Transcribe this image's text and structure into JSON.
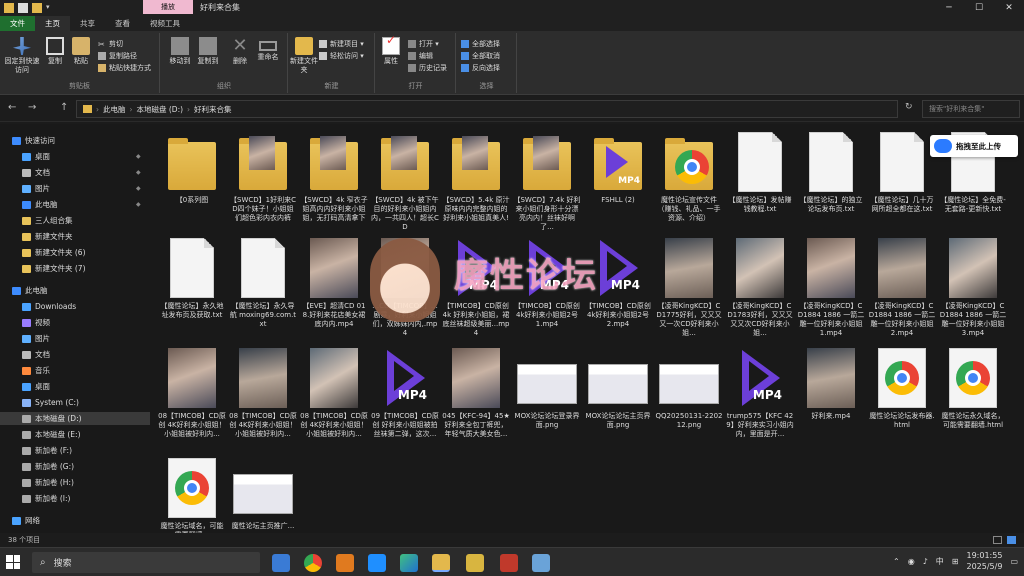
{
  "titlebar": {
    "context_tab": "播放",
    "title": "好利来合集",
    "controls": [
      "─",
      "☐",
      "✕"
    ]
  },
  "ribbon_tabs": [
    "文件",
    "主页",
    "共享",
    "查看",
    "视频工具"
  ],
  "ribbon": {
    "clipboard": {
      "group": "剪贴板",
      "pin": "固定到快速访问",
      "copy": "复制",
      "paste": "粘贴",
      "cut": "剪切",
      "copy_path": "复制路径",
      "paste_shortcut": "粘贴快捷方式"
    },
    "organize": {
      "group": "组织",
      "move_to": "移动到",
      "copy_to": "复制到",
      "delete": "删除",
      "rename": "重命名"
    },
    "new": {
      "group": "新建",
      "new_folder": "新建文件夹",
      "new_item": "新建项目 ▾",
      "easy_access": "轻松访问 ▾"
    },
    "open": {
      "group": "打开",
      "properties": "属性",
      "open": "打开 ▾",
      "edit": "编辑",
      "history": "历史记录"
    },
    "select": {
      "group": "选择",
      "select_all": "全部选择",
      "select_none": "全部取消",
      "invert": "反向选择"
    }
  },
  "address": {
    "back": "←",
    "forward": "→",
    "up": "↑",
    "parts": [
      "此电脑",
      "本地磁盘 (D:)",
      "好利来合集"
    ],
    "search_placeholder": "搜索\"好利来合集\""
  },
  "sidebar": [
    {
      "label": "快速访问",
      "color": "#3d8bfd",
      "indent": 0,
      "pin": ""
    },
    {
      "label": "桌面",
      "color": "#4aa3ff",
      "indent": 1,
      "pin": "📌"
    },
    {
      "label": "文档",
      "color": "#bbbbbb",
      "indent": 1,
      "pin": "📌"
    },
    {
      "label": "图片",
      "color": "#5fb0ff",
      "indent": 1,
      "pin": "📌"
    },
    {
      "label": "此电脑",
      "color": "#3d8bfd",
      "indent": 1,
      "pin": "📌"
    },
    {
      "label": "三人组合集",
      "color": "#e8c35a",
      "indent": 1,
      "pin": ""
    },
    {
      "label": "新建文件夹",
      "color": "#e8c35a",
      "indent": 1,
      "pin": ""
    },
    {
      "label": "新建文件夹 (6)",
      "color": "#e8c35a",
      "indent": 1,
      "pin": ""
    },
    {
      "label": "新建文件夹 (7)",
      "color": "#e8c35a",
      "indent": 1,
      "pin": ""
    },
    {
      "label": "此电脑",
      "color": "#3d8bfd",
      "indent": 0,
      "pin": ""
    },
    {
      "label": "Downloads",
      "color": "#4aa3ff",
      "indent": 1,
      "pin": ""
    },
    {
      "label": "视频",
      "color": "#9a7cff",
      "indent": 1,
      "pin": ""
    },
    {
      "label": "图片",
      "color": "#5fb0ff",
      "indent": 1,
      "pin": ""
    },
    {
      "label": "文档",
      "color": "#bbbbbb",
      "indent": 1,
      "pin": ""
    },
    {
      "label": "音乐",
      "color": "#ff8a3d",
      "indent": 1,
      "pin": ""
    },
    {
      "label": "桌面",
      "color": "#4aa3ff",
      "indent": 1,
      "pin": ""
    },
    {
      "label": "System (C:)",
      "color": "#8ab4f8",
      "indent": 1,
      "pin": ""
    },
    {
      "label": "本地磁盘 (D:)",
      "color": "#aaaaaa",
      "indent": 1,
      "pin": "",
      "selected": true
    },
    {
      "label": "本地磁盘 (E:)",
      "color": "#aaaaaa",
      "indent": 1,
      "pin": ""
    },
    {
      "label": "新加卷 (F:)",
      "color": "#aaaaaa",
      "indent": 1,
      "pin": ""
    },
    {
      "label": "新加卷 (G:)",
      "color": "#aaaaaa",
      "indent": 1,
      "pin": ""
    },
    {
      "label": "新加卷 (H:)",
      "color": "#aaaaaa",
      "indent": 1,
      "pin": ""
    },
    {
      "label": "新加卷 (I:)",
      "color": "#aaaaaa",
      "indent": 1,
      "pin": ""
    },
    {
      "label": "网络",
      "color": "#4aa3ff",
      "indent": 0,
      "pin": ""
    }
  ],
  "files": [
    {
      "kind": "folder",
      "label": "【0系列图"
    },
    {
      "kind": "folder",
      "label": "【SWCD】1好利来CD四个妹子！小姐姐们超色彩内衣内裤"
    },
    {
      "kind": "folder",
      "label": "【SWCD】4k 窄衣子姐高内内好利来小姐姐，无打码高清拿下"
    },
    {
      "kind": "folder",
      "label": "【SWCD】4k 被下午目的好利来小姐姐内内，一共四人！超长CD"
    },
    {
      "kind": "folder",
      "label": "【SWCD】5.4k 原汁原味内内完整内姐的好利来小姐姐真美人!"
    },
    {
      "kind": "folder",
      "label": "【SWCD】7.4k 好利来小姐们身形十分漂亮内内！丝袜好啊了..."
    },
    {
      "kind": "folder-play",
      "label": "FSHLL (2)"
    },
    {
      "kind": "folder-chrome",
      "label": "魔性论坛宣传文件（赚钱、礼品、一手资源、介绍）"
    },
    {
      "kind": "doc",
      "label": "【魔性论坛】发帖赚钱教程.txt"
    },
    {
      "kind": "doc",
      "label": "【魔性论坛】的独立论坛发布页.txt"
    },
    {
      "kind": "doc",
      "label": "【魔性论坛】几十万网所超全都在这.txt"
    },
    {
      "kind": "doc",
      "label": "【魔性论坛】全免费-无套路-更新快.txt"
    },
    {
      "kind": "doc",
      "label": "【魔性论坛】永久地址发布页及获取.txt"
    },
    {
      "kind": "doc",
      "label": "【魔性论坛】永久导航 moxing69.com.txt"
    },
    {
      "kind": "photo",
      "label": "【EVE】超清CD 018.好利来花店美女裙底内内.mp4"
    },
    {
      "kind": "photo",
      "label": "…CD【TIMCOB】…剧乘，好利来小姐姐们，双姊妹内内,.mp4"
    },
    {
      "kind": "mp4",
      "label": "【TIMCOB】CD原创 4k 好利来小姐姐，裙底丝袜超级美丽...mp4"
    },
    {
      "kind": "mp4",
      "label": "【TIMCOB】CD原创 4k好利来小姐姐2号1.mp4"
    },
    {
      "kind": "mp4",
      "label": "【TIMCOB】CD原创 4k好利来小姐姐2号2.mp4"
    },
    {
      "kind": "photo2",
      "label": "【凌哥KingKCD】CD1775好利，又又又又一次CD好利来小姐..."
    },
    {
      "kind": "photo3",
      "label": "【凌哥KingKCD】CD1783好利，又又又又又次CD好利来小姐..."
    },
    {
      "kind": "photo",
      "label": "【凌哥KingKCD】CD1884 1886 一箭二雕一位好利来小姐姐1.mp4"
    },
    {
      "kind": "photo2",
      "label": "【凌哥KingKCD】CD1884 1886 一箭二雕一位好利来小姐姐2.mp4"
    },
    {
      "kind": "photo3",
      "label": "【凌哥KingKCD】CD1884 1886 一箭二雕一位好利来小姐姐3.mp4"
    },
    {
      "kind": "photo",
      "label": "08【TIMCOB】CD原创 4K好利来小姐姐！小姐姐被好利内..."
    },
    {
      "kind": "photo2",
      "label": "08【TIMCOB】CD原创 4K好利来小姐姐！小姐姐被好利内..."
    },
    {
      "kind": "photo3",
      "label": "08【TIMCOB】CD原创 4K好利来小姐姐！小姐姐被好利内..."
    },
    {
      "kind": "mp4",
      "label": "09【TIMCOB】CD原创 好利来小姐姐被拍丝袜第二弹，这次..."
    },
    {
      "kind": "photo",
      "label": "045【KFC-94】45★好利来全包丁裤兜，年轻气质大美女色..."
    },
    {
      "kind": "shot",
      "label": "MOX论坛论坛登录界面.png"
    },
    {
      "kind": "shot",
      "label": "MOX论坛论坛主页界面.png"
    },
    {
      "kind": "shot",
      "label": "QQ20250131-220212.png"
    },
    {
      "kind": "mp4",
      "label": "trump575【KFC 429】好利来实习小姐内内，里面是开..."
    },
    {
      "kind": "photo2",
      "label": "好利来.mp4"
    },
    {
      "kind": "chrome",
      "label": "魔性论坛论坛发布器.html"
    },
    {
      "kind": "chrome",
      "label": "魔性论坛永久域名，可能需要翻墙.html"
    },
    {
      "kind": "chrome",
      "label": "魔性论坛域名，可能需要翻墙..."
    },
    {
      "kind": "shot",
      "label": "魔性论坛主页推广..."
    }
  ],
  "mp4_label": "MP4",
  "overlay": {
    "upload": "拖拽至此上传",
    "watermark": "魔性论坛"
  },
  "status": {
    "count": "38 个项目"
  },
  "taskbar": {
    "search": "搜索",
    "tray_ime": "中",
    "time": "19:01:55",
    "date": "2025/5/9"
  }
}
